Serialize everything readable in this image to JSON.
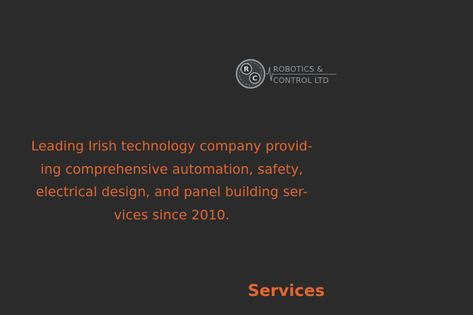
{
  "logo": {
    "monogram_top": "R",
    "monogram_bottom": "C",
    "name_line1": "ROBOTICS &",
    "name_line2": "CONTROL LTD",
    "icon": "gear-circuit-logo-icon",
    "color": "#8f969b"
  },
  "hero": {
    "tagline_lines": [
      "Leading Irish technology company provid-",
      "ing comprehensive automation, safety,",
      "electrical design, and panel building ser-",
      "vices since 2010."
    ]
  },
  "services": {
    "heading": "Services"
  },
  "colors": {
    "background": "#2b2b2b",
    "accent": "#e2672e",
    "logo_grey": "#8f969b"
  }
}
